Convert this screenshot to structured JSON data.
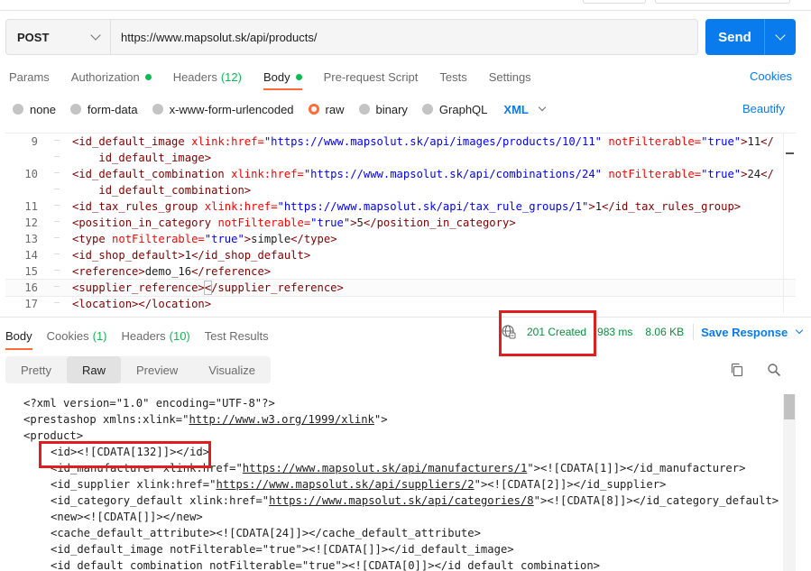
{
  "request": {
    "method": "POST",
    "url": "https://www.mapsolut.sk/api/products/",
    "send_label": "Send"
  },
  "request_tabs": [
    {
      "label": "Params"
    },
    {
      "label": "Authorization",
      "dot": true
    },
    {
      "label": "Headers",
      "count": "(12)"
    },
    {
      "label": "Body",
      "dot": true,
      "active": true
    },
    {
      "label": "Pre-request Script"
    },
    {
      "label": "Tests"
    },
    {
      "label": "Settings"
    }
  ],
  "cookies_label": "Cookies",
  "body_types": [
    {
      "label": "none"
    },
    {
      "label": "form-data"
    },
    {
      "label": "x-www-form-urlencoded"
    },
    {
      "label": "raw",
      "selected": true
    },
    {
      "label": "binary"
    },
    {
      "label": "GraphQL"
    }
  ],
  "body_format": "XML",
  "beautify_label": "Beautify",
  "editor_lines": [
    {
      "num": "9",
      "html": "<span class=\"tg\">&lt;id_default_image</span> <span class=\"at\">xlink:href=</span><span class=\"av\">\"https://www.mapsolut.sk/api/images/products/10/11\"</span> <span class=\"at\">notFilterable=</span><span class=\"av\">\"true\"</span><span class=\"tg\">&gt;</span>11<span class=\"tg\">&lt;/</span>"
    },
    {
      "num": "",
      "html": "    <span class=\"tg\">id_default_image&gt;</span>"
    },
    {
      "num": "10",
      "html": "<span class=\"tg\">&lt;id_default_combination</span> <span class=\"at\">xlink:href=</span><span class=\"av\">\"https://www.mapsolut.sk/api/combinations/24\"</span> <span class=\"at\">notFilterable=</span><span class=\"av\">\"true\"</span><span class=\"tg\">&gt;</span>24<span class=\"tg\">&lt;/</span>"
    },
    {
      "num": "",
      "html": "    <span class=\"tg\">id_default_combination&gt;</span>"
    },
    {
      "num": "11",
      "html": "<span class=\"tg\">&lt;id_tax_rules_group</span> <span class=\"at\">xlink:href=</span><span class=\"av\">\"https://www.mapsolut.sk/api/tax_rule_groups/1\"</span><span class=\"tg\">&gt;</span>1<span class=\"tg\">&lt;/id_tax_rules_group&gt;</span>"
    },
    {
      "num": "12",
      "html": "<span class=\"tg\">&lt;position_in_category</span> <span class=\"at\">notFilterable=</span><span class=\"av\">\"true\"</span><span class=\"tg\">&gt;</span>5<span class=\"tg\">&lt;/position_in_category&gt;</span>"
    },
    {
      "num": "13",
      "html": "<span class=\"tg\">&lt;type</span> <span class=\"at\">notFilterable=</span><span class=\"av\">\"true\"</span><span class=\"tg\">&gt;</span>simple<span class=\"tg\">&lt;/type&gt;</span>"
    },
    {
      "num": "14",
      "html": "<span class=\"tg\">&lt;id_shop_default&gt;</span>1<span class=\"tg\">&lt;/id_shop_default&gt;</span>"
    },
    {
      "num": "15",
      "html": "<span class=\"tg\">&lt;reference&gt;</span>demo_16<span class=\"tg\">&lt;/reference&gt;</span>"
    },
    {
      "num": "16",
      "html": "<span class=\"tg\">&lt;supplier_reference&gt;</span><span class=\"tg\" style=\"outline:1px solid #bbb\">&lt;</span><span class=\"tg\">/supplier_reference&gt;</span>",
      "current": true
    },
    {
      "num": "17",
      "html": "<span class=\"tg\">&lt;location&gt;&lt;/location&gt;</span>"
    }
  ],
  "response_tabs": [
    {
      "label": "Body",
      "active": true
    },
    {
      "label": "Cookies",
      "count": "(1)"
    },
    {
      "label": "Headers",
      "count": "(10)"
    },
    {
      "label": "Test Results"
    }
  ],
  "response_status": {
    "code": "201 Created",
    "time": "983 ms",
    "size": "8.06 KB",
    "save_label": "Save Response"
  },
  "view_modes": [
    {
      "label": "Pretty"
    },
    {
      "label": "Raw",
      "active": true
    },
    {
      "label": "Preview"
    },
    {
      "label": "Visualize"
    }
  ],
  "response_lines": [
    {
      "indent": 0,
      "text": "<?xml version=\"1.0\" encoding=\"UTF-8\"?>"
    },
    {
      "indent": 0,
      "pre": "<prestashop xmlns:xlink=\"",
      "link": "http://www.w3.org/1999/xlink",
      "post": "\">"
    },
    {
      "indent": 0,
      "text": "<product>"
    },
    {
      "indent": 1,
      "text": "<id><![CDATA[132]]></id>"
    },
    {
      "indent": 1,
      "pre": "<id_manufacturer xlink:href=\"",
      "link": "https://www.mapsolut.sk/api/manufacturers/1",
      "post": "\"><![CDATA[1]]></id_manufacturer>"
    },
    {
      "indent": 1,
      "pre": "<id_supplier xlink:href=\"",
      "link": "https://www.mapsolut.sk/api/suppliers/2",
      "post": "\"><![CDATA[2]]></id_supplier>"
    },
    {
      "indent": 1,
      "pre": "<id_category_default xlink:href=\"",
      "link": "https://www.mapsolut.sk/api/categories/8",
      "post": "\"><![CDATA[8]]></id_category_default>"
    },
    {
      "indent": 1,
      "text": "<new><![CDATA[]]></new>"
    },
    {
      "indent": 1,
      "text": "<cache_default_attribute><![CDATA[24]]></cache_default_attribute>"
    },
    {
      "indent": 1,
      "text": "<id_default_image notFilterable=\"true\"><![CDATA[]]></id_default_image>"
    },
    {
      "indent": 1,
      "text": "<id_default_combination notFilterable=\"true\"><![CDATA[0]]></id_default_combination>"
    }
  ],
  "colors": {
    "accent": "#097bed",
    "tab_indicator": "#ff6c37",
    "status_ok": "#0cbb52",
    "highlight": "#e01e1e"
  }
}
